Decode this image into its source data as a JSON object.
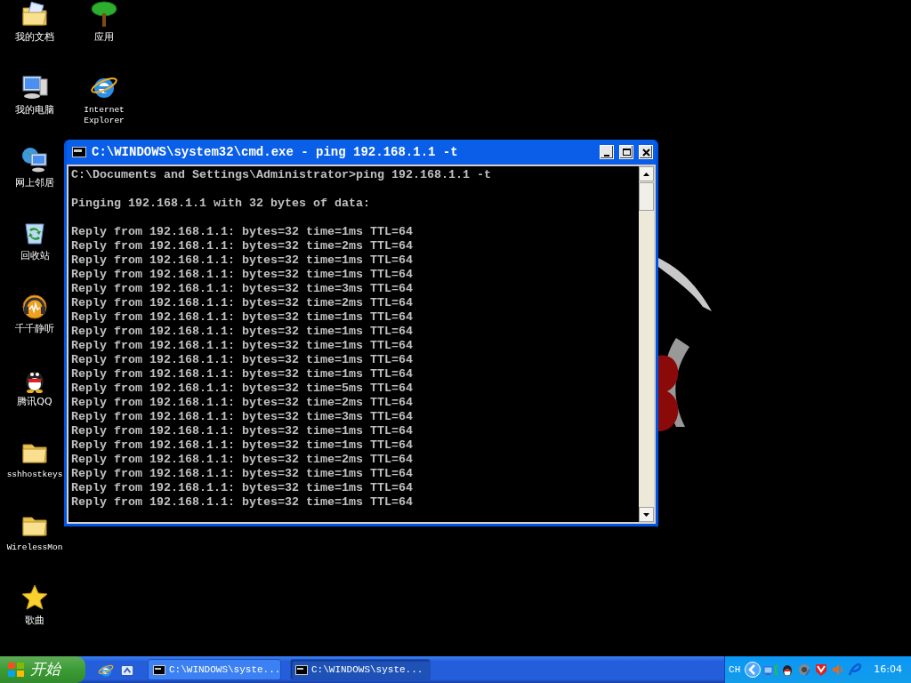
{
  "desktop_icons": [
    {
      "label": "我的文档",
      "kind": "documents"
    },
    {
      "label": "我的电脑",
      "kind": "computer"
    },
    {
      "label": "网上邻居",
      "kind": "network"
    },
    {
      "label": "回收站",
      "kind": "recycle"
    },
    {
      "label": "千千静听",
      "kind": "player"
    },
    {
      "label": "腾讯QQ",
      "kind": "penguin"
    },
    {
      "label": "sshhostkeys",
      "kind": "folder"
    },
    {
      "label": "WirelessMon",
      "kind": "folder"
    },
    {
      "label": "歌曲",
      "kind": "star"
    },
    {
      "label": "应用",
      "kind": "tree"
    },
    {
      "label": "Internet Explorer",
      "kind": "browser"
    }
  ],
  "cmd_window": {
    "title": "C:\\WINDOWS\\system32\\cmd.exe - ping 192.168.1.1 -t",
    "prompt_line": "C:\\Documents and Settings\\Administrator>ping 192.168.1.1 -t",
    "header_line": "Pinging 192.168.1.1 with 32 bytes of data:",
    "replies": [
      "Reply from 192.168.1.1: bytes=32 time=1ms TTL=64",
      "Reply from 192.168.1.1: bytes=32 time=2ms TTL=64",
      "Reply from 192.168.1.1: bytes=32 time=1ms TTL=64",
      "Reply from 192.168.1.1: bytes=32 time=1ms TTL=64",
      "Reply from 192.168.1.1: bytes=32 time=3ms TTL=64",
      "Reply from 192.168.1.1: bytes=32 time=2ms TTL=64",
      "Reply from 192.168.1.1: bytes=32 time=1ms TTL=64",
      "Reply from 192.168.1.1: bytes=32 time=1ms TTL=64",
      "Reply from 192.168.1.1: bytes=32 time=1ms TTL=64",
      "Reply from 192.168.1.1: bytes=32 time=1ms TTL=64",
      "Reply from 192.168.1.1: bytes=32 time=1ms TTL=64",
      "Reply from 192.168.1.1: bytes=32 time=5ms TTL=64",
      "Reply from 192.168.1.1: bytes=32 time=2ms TTL=64",
      "Reply from 192.168.1.1: bytes=32 time=3ms TTL=64",
      "Reply from 192.168.1.1: bytes=32 time=1ms TTL=64",
      "Reply from 192.168.1.1: bytes=32 time=1ms TTL=64",
      "Reply from 192.168.1.1: bytes=32 time=2ms TTL=64",
      "Reply from 192.168.1.1: bytes=32 time=1ms TTL=64",
      "Reply from 192.168.1.1: bytes=32 time=1ms TTL=64",
      "Reply from 192.168.1.1: bytes=32 time=1ms TTL=64"
    ]
  },
  "taskbar": {
    "start_label": "开始",
    "quick_launch": [
      {
        "kind": "browser"
      },
      {
        "kind": "desktop"
      }
    ],
    "tasks": [
      {
        "label": "C:\\WINDOWS\\syste...",
        "selected": false
      },
      {
        "label": "C:\\WINDOWS\\syste...",
        "selected": true
      }
    ],
    "tray": {
      "language": "CH",
      "icons": [
        {
          "kind": "network"
        },
        {
          "kind": "penguin"
        },
        {
          "kind": "speaker-gray"
        },
        {
          "kind": "shield"
        },
        {
          "kind": "volume"
        },
        {
          "kind": "swirl"
        }
      ],
      "clock": "16:04"
    }
  }
}
